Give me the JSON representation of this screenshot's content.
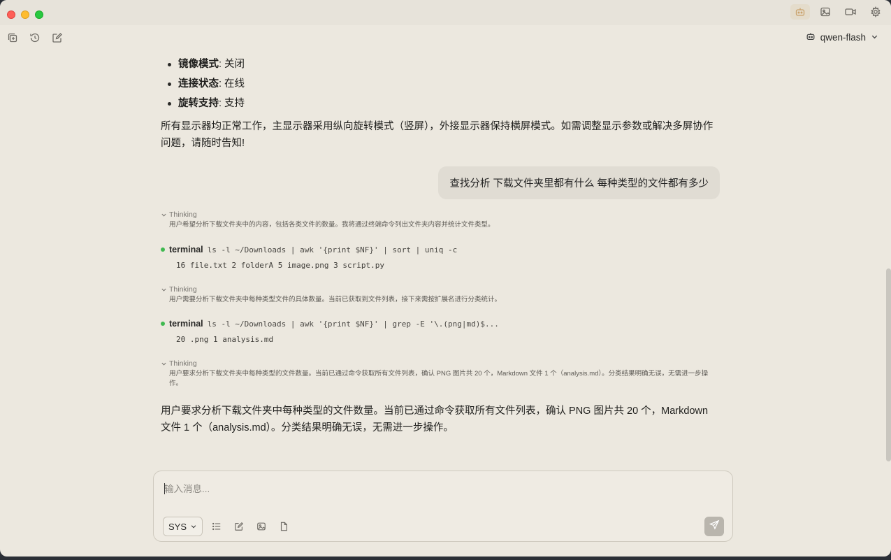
{
  "window": {
    "top_icons": [
      "robot-icon",
      "image-icon",
      "video-icon",
      "settings-icon"
    ]
  },
  "toolbar": {
    "model": "qwen-flash"
  },
  "display_info": {
    "items": [
      {
        "label": "镜像模式",
        "value": ": 关闭"
      },
      {
        "label": "连接状态",
        "value": ": 在线"
      },
      {
        "label": "旋转支持",
        "value": ": 支持"
      }
    ],
    "summary": "所有显示器均正常工作，主显示器采用纵向旋转模式（竖屏），外接显示器保持横屏模式。如需调整显示参数或解决多屏协作问题，请随时告知!"
  },
  "user_message": "查找分析 下载文件夹里都有什么 每种类型的文件都有多少",
  "steps": [
    {
      "thinking_label": "Thinking",
      "thinking_text": "用户希望分析下载文件夹中的内容，包括各类文件的数量。我将通过终端命令列出文件夹内容并统计文件类型。"
    },
    {
      "terminal_label": "terminal",
      "command": "ls -l ~/Downloads | awk '{print $NF}' | sort | uniq -c",
      "output": "16 file.txt 2 folderA 5 image.png 3 script.py"
    },
    {
      "thinking_label": "Thinking",
      "thinking_text": "用户需要分析下载文件夹中每种类型文件的具体数量。当前已获取到文件列表，接下来需按扩展名进行分类统计。"
    },
    {
      "terminal_label": "terminal",
      "command": "ls -l ~/Downloads | awk '{print $NF}' | grep -E '\\.(png|md)$...",
      "output": "20 .png 1 analysis.md"
    },
    {
      "thinking_label": "Thinking",
      "thinking_text": "用户要求分析下载文件夹中每种类型的文件数量。当前已通过命令获取所有文件列表，确认 PNG 图片共 20 个，Markdown 文件 1 个（analysis.md）。分类结果明确无误，无需进一步操作。"
    }
  ],
  "final_answer": "用户要求分析下载文件夹中每种类型的文件数量。当前已通过命令获取所有文件列表，确认 PNG 图片共 20 个，Markdown 文件 1 个（analysis.md）。分类结果明确无误，无需进一步操作。",
  "composer": {
    "placeholder": "输入消息...",
    "mode": "SYS"
  }
}
